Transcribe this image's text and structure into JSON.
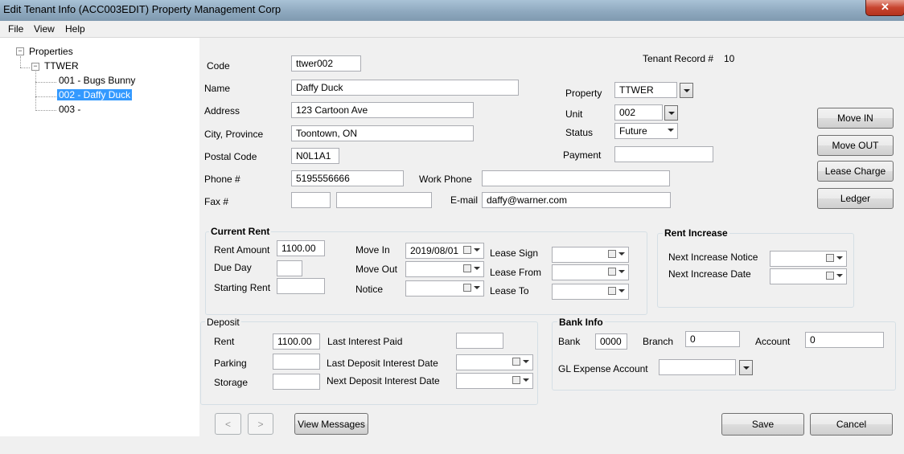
{
  "window": {
    "title": "Edit Tenant Info (ACC003EDIT)  Property Management Corp",
    "close_glyph": "✕"
  },
  "menu": [
    "File",
    "View",
    "Help"
  ],
  "tree": {
    "root": "Properties",
    "property": "TTWER",
    "units": [
      "001 - Bugs Bunny",
      "002 - Daffy Duck",
      "003 -"
    ],
    "selected_index": 1,
    "expander_glyph": "−"
  },
  "tenant": {
    "record_label": "Tenant Record #",
    "record_value": "10",
    "code_label": "Code",
    "code": "ttwer002",
    "name_label": "Name",
    "name": "Daffy Duck",
    "address_label": "Address",
    "address": "123 Cartoon Ave",
    "city_label": "City, Province",
    "city": "Toontown, ON",
    "postal_label": "Postal Code",
    "postal": "N0L1A1",
    "phone_label": "Phone #",
    "phone": "5195556666",
    "work_phone_label": "Work Phone",
    "work_phone": "",
    "fax_label": "Fax #",
    "fax_1": "",
    "fax_2": "",
    "email_label": "E-mail",
    "email": "daffy@warner.com",
    "property_label": "Property",
    "property": "TTWER",
    "unit_label": "Unit",
    "unit": "002",
    "status_label": "Status",
    "status": "Future",
    "payment_label": "Payment",
    "payment": ""
  },
  "actions": {
    "move_in": "Move IN",
    "move_out": "Move OUT",
    "lease_charge": "Lease Charge",
    "ledger": "Ledger"
  },
  "current_rent": {
    "title": "Current Rent",
    "rent_amount_label": "Rent Amount",
    "rent_amount": "1100.00",
    "due_day_label": "Due Day",
    "due_day": "",
    "starting_rent_label": "Starting Rent",
    "starting_rent": "",
    "move_in_label": "Move In",
    "move_in": "2019/08/01",
    "move_out_label": "Move Out",
    "move_out": "",
    "notice_label": "Notice",
    "notice": "",
    "lease_sign_label": "Lease Sign",
    "lease_sign": "",
    "lease_from_label": "Lease From",
    "lease_from": "",
    "lease_to_label": "Lease To",
    "lease_to": ""
  },
  "rent_increase": {
    "title": "Rent Increase",
    "next_notice_label": "Next Increase Notice",
    "next_notice": "",
    "next_date_label": "Next Increase Date",
    "next_date": ""
  },
  "deposit": {
    "title": "Deposit",
    "rent_label": "Rent",
    "rent": "1100.00",
    "parking_label": "Parking",
    "parking": "",
    "storage_label": "Storage",
    "storage": "",
    "last_interest_paid_label": "Last Interest Paid",
    "last_interest_paid": "",
    "last_deposit_interest_label": "Last Deposit Interest Date",
    "last_deposit_interest": "",
    "next_deposit_interest_label": "Next Deposit Interest Date",
    "next_deposit_interest": ""
  },
  "bank": {
    "title": "Bank Info",
    "bank_label": "Bank",
    "bank": "0000",
    "branch_label": "Branch",
    "branch": "0",
    "account_label": "Account",
    "account": "0",
    "gl_label": "GL Expense Account",
    "gl": ""
  },
  "footer": {
    "prev": "<",
    "next": ">",
    "view_messages": "View Messages",
    "save": "Save",
    "cancel": "Cancel"
  }
}
